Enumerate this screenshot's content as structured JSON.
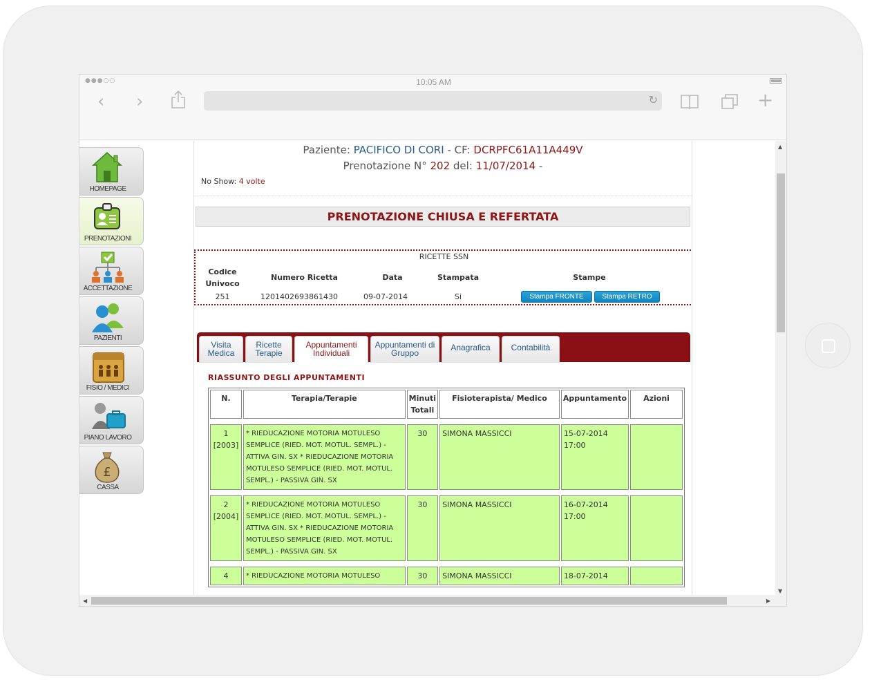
{
  "browser": {
    "time": "10:05 AM",
    "signal": "●●●○○"
  },
  "menu": [
    {
      "label": "HOMEPAGE",
      "icon": "home-icon"
    },
    {
      "label": "PRENOTAZIONI",
      "icon": "id-badge-icon"
    },
    {
      "label": "ACCETTAZIONE",
      "icon": "org-chart-icon"
    },
    {
      "label": "PAZIENTI",
      "icon": "patients-icon"
    },
    {
      "label": "FISIO / MEDICI",
      "icon": "staff-icon"
    },
    {
      "label": "PIANO LAVORO",
      "icon": "briefcase-icon"
    },
    {
      "label": "CASSA",
      "icon": "money-bag-icon"
    }
  ],
  "header": {
    "paziente_label": "Paziente:",
    "paziente_name": "PACIFICO DI CORI",
    "cf_label": "- CF:",
    "cf_value": "DCRPFC61A11A449V",
    "pren_label": "Prenotazione N°",
    "pren_num": "202",
    "del_label": "del:",
    "pren_date": "11/07/2014",
    "pren_dash": "-",
    "noshow_label": "No Show:",
    "noshow_value": "4 volte"
  },
  "status": "PRENOTAZIONE CHIUSA E REFERTATA",
  "ricette": {
    "title": "RICETTE SSN",
    "headers": {
      "codice": "Codice Univoco",
      "numero": "Numero Ricetta",
      "data": "Data",
      "stampata": "Stampata",
      "stampe": "Stampe"
    },
    "row": {
      "codice": "251",
      "numero": "1201402693861430",
      "data": "09-07-2014",
      "stampata": "Si"
    },
    "btn_fronte": "Stampa FRONTE",
    "btn_retro": "Stampa RETRO"
  },
  "tabs": [
    {
      "label": "Visita Medica"
    },
    {
      "label": "Ricette Terapie"
    },
    {
      "label": "Appuntamenti Individuali"
    },
    {
      "label": "Appuntamenti di Gruppo"
    },
    {
      "label": "Anagrafica"
    },
    {
      "label": "Contabilità"
    }
  ],
  "summary_title": "RIASSUNTO DEGLI APPUNTAMENTI",
  "table": {
    "headers": {
      "n": "N.",
      "terapia": "Terapia/Terapie",
      "minuti": "Minuti Totali",
      "fisio": "Fisioterapista/ Medico",
      "appuntamento": "Appuntamento",
      "azioni": "Azioni"
    },
    "rows": [
      {
        "n": "1",
        "code": "[2003]",
        "terapia": "* RIEDUCAZIONE MOTORIA MOTULESO SEMPLICE (RIED. MOT. MOTUL. SEMPL.) - ATTIVA GIN. SX * RIEDUCAZIONE MOTORIA MOTULESO SEMPLICE (RIED. MOT. MOTUL. SEMPL.) - PASSIVA GIN. SX",
        "minuti": "30",
        "fisio": "SIMONA MASSICCI",
        "data": "15-07-2014",
        "ora": "17:00"
      },
      {
        "n": "2",
        "code": "[2004]",
        "terapia": "* RIEDUCAZIONE MOTORIA MOTULESO SEMPLICE (RIED. MOT. MOTUL. SEMPL.) - ATTIVA GIN. SX * RIEDUCAZIONE MOTORIA MOTULESO SEMPLICE (RIED. MOT. MOTUL. SEMPL.) - PASSIVA GIN. SX",
        "minuti": "30",
        "fisio": "SIMONA MASSICCI",
        "data": "16-07-2014",
        "ora": "17:00"
      },
      {
        "n": "4",
        "code": "",
        "terapia": "* RIEDUCAZIONE MOTORIA MOTULESO",
        "minuti": "30",
        "fisio": "SIMONA MASSICCI",
        "data": "18-07-2014",
        "ora": ""
      }
    ]
  }
}
